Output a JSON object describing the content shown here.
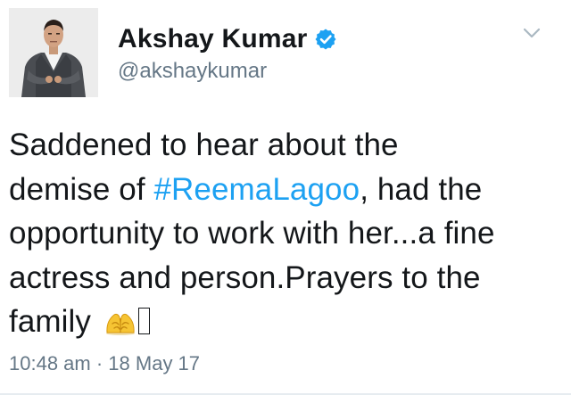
{
  "author": {
    "display_name": "Akshay Kumar",
    "handle": "@akshaykumar",
    "verified": true,
    "avatar": "profile-photo-man-grey-suit"
  },
  "tweet": {
    "lines": [
      {
        "before": "Saddened to hear about the",
        "hashtag": "",
        "after": ""
      },
      {
        "before": "demise of ",
        "hashtag": "#ReemaLagoo",
        "after": ", had the"
      },
      {
        "before": "opportunity to work with her...a fine",
        "hashtag": "",
        "after": ""
      },
      {
        "before": "actress and person.Prayers to the",
        "hashtag": "",
        "after": ""
      },
      {
        "before": "family ",
        "hashtag": "",
        "after": ""
      }
    ],
    "emoji": [
      "folded-hands-emoji",
      "missing-glyph-box"
    ]
  },
  "meta": {
    "time": "10:48 am",
    "separator": " · ",
    "date": "18 May 17"
  },
  "colors": {
    "text": "#14171a",
    "secondary": "#657786",
    "hashtag": "#1da1f2",
    "verified_badge": "#1da1f2"
  }
}
